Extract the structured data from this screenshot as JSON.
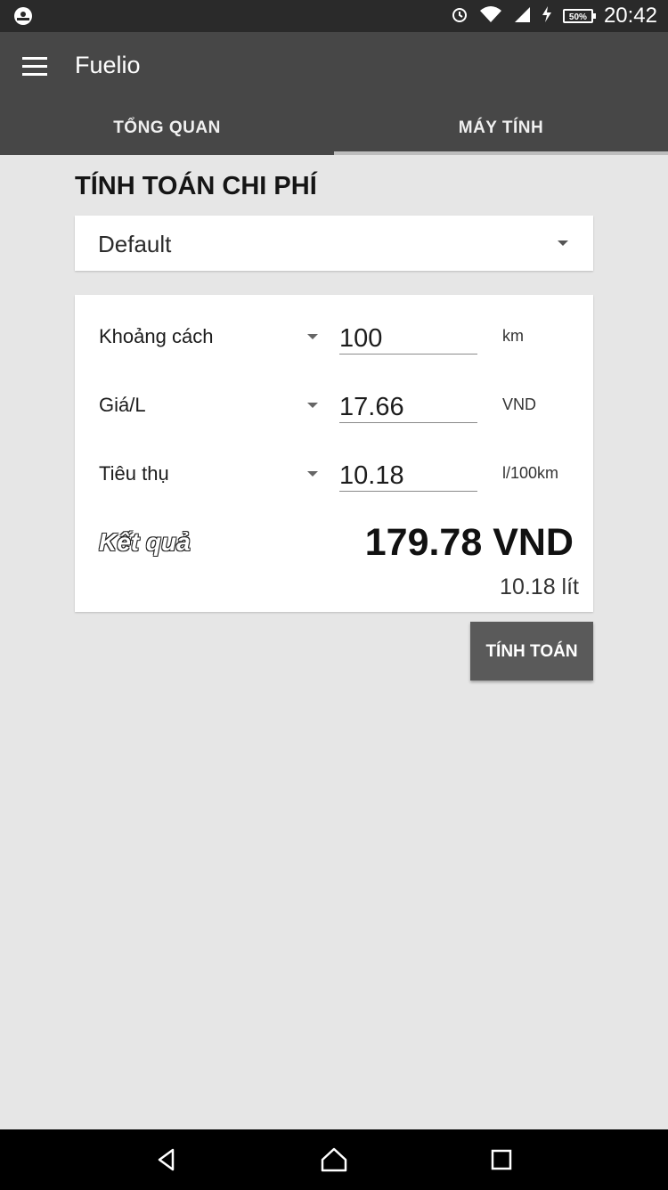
{
  "status_bar": {
    "battery_percent": "50%",
    "time": "20:42",
    "icons": [
      "app-notification-icon",
      "alarm-icon",
      "wifi-icon",
      "signal-icon",
      "charging-icon",
      "battery-icon"
    ]
  },
  "app_bar": {
    "title": "Fuelio",
    "tabs": [
      {
        "label": "TỔNG QUAN",
        "active": false
      },
      {
        "label": "MÁY TÍNH",
        "active": true
      }
    ]
  },
  "calculator": {
    "title": "TÍNH TOÁN CHI PHÍ",
    "vehicle_selected": "Default",
    "rows": [
      {
        "label": "Khoảng cách",
        "value": "100",
        "unit": "km"
      },
      {
        "label": "Giá/L",
        "value": "17.66",
        "unit": "VND"
      },
      {
        "label": "Tiêu thụ",
        "value": "10.18",
        "unit": "l/100km"
      }
    ],
    "result_label": "Kết quả",
    "result_value": "179.78 VND",
    "result_fuel": "10.18 lít",
    "calculate_button": "TÍNH TOÁN"
  },
  "colors": {
    "status_bar": "#2a2a2a",
    "app_bar": "#474747",
    "background": "#e6e6e6",
    "button": "#5a5a5a",
    "nav_bar": "#000000"
  },
  "nav_bar": {
    "icons": [
      "back-icon",
      "home-icon",
      "recents-icon"
    ]
  }
}
